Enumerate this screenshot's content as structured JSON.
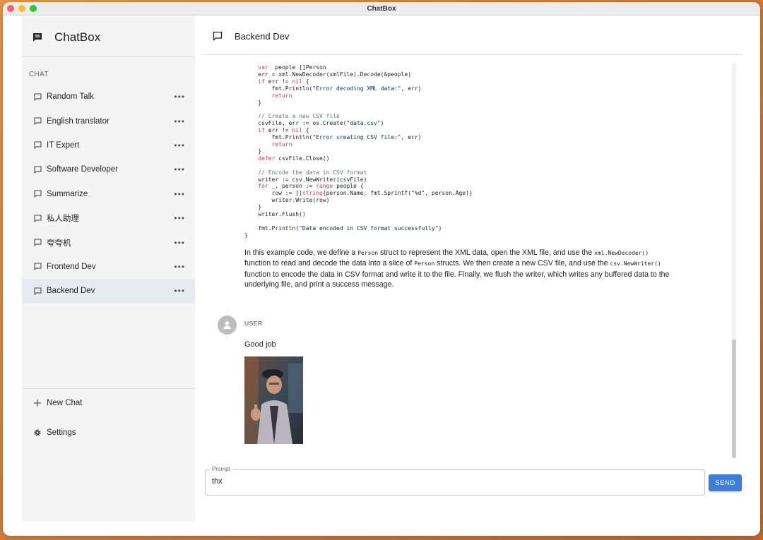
{
  "window": {
    "title": "ChatBox"
  },
  "sidebar": {
    "brand": "ChatBox",
    "section_label": "CHAT",
    "items": [
      {
        "label": "Random Talk"
      },
      {
        "label": "English translator"
      },
      {
        "label": "IT Expert"
      },
      {
        "label": "Software Developer"
      },
      {
        "label": "Summarize"
      },
      {
        "label": "私人助理"
      },
      {
        "label": "夸夸机"
      },
      {
        "label": "Frontend Dev"
      },
      {
        "label": "Backend Dev",
        "active": true
      }
    ],
    "more_glyph": "•••",
    "new_chat": "New Chat",
    "settings": "Settings"
  },
  "main": {
    "title": "Backend Dev",
    "code_lines": [
      {
        "parts": [
          [
            "kw",
            "    var"
          ],
          [
            "",
            "  people []Person"
          ]
        ]
      },
      {
        "parts": [
          [
            "",
            "    err = xml.NewDecoder(xmlFile).Decode(&people)"
          ]
        ]
      },
      {
        "parts": [
          [
            "kw",
            "    if"
          ],
          [
            "",
            " err != "
          ],
          [
            "kw",
            "nil"
          ],
          [
            "",
            " {"
          ]
        ]
      },
      {
        "parts": [
          [
            "",
            "        fmt.Println("
          ],
          [
            "str",
            "\"Error decoding XML data:\""
          ],
          [
            "",
            ", err)"
          ]
        ]
      },
      {
        "parts": [
          [
            "kw",
            "        return"
          ]
        ]
      },
      {
        "parts": [
          [
            "",
            "    }"
          ]
        ]
      },
      {
        "parts": [
          [
            "",
            ""
          ]
        ]
      },
      {
        "parts": [
          [
            "cm",
            "    // Create a new CSV file"
          ]
        ]
      },
      {
        "parts": [
          [
            "",
            "    csvFile, err := os.Create("
          ],
          [
            "str",
            "\"data.csv\""
          ],
          [
            "",
            ")"
          ]
        ]
      },
      {
        "parts": [
          [
            "kw",
            "    if"
          ],
          [
            "",
            " err != "
          ],
          [
            "kw",
            "nil"
          ],
          [
            "",
            " {"
          ]
        ]
      },
      {
        "parts": [
          [
            "",
            "        fmt.Println("
          ],
          [
            "str",
            "\"Error creating CSV file:\""
          ],
          [
            "",
            ", err)"
          ]
        ]
      },
      {
        "parts": [
          [
            "kw",
            "        return"
          ]
        ]
      },
      {
        "parts": [
          [
            "",
            "    }"
          ]
        ]
      },
      {
        "parts": [
          [
            "kw",
            "    defer"
          ],
          [
            "",
            " csvFile.Close()"
          ]
        ]
      },
      {
        "parts": [
          [
            "",
            ""
          ]
        ]
      },
      {
        "parts": [
          [
            "cm",
            "    // Encode the data in CSV format"
          ]
        ]
      },
      {
        "parts": [
          [
            "",
            "    writer := csv.NewWriter(csvFile)"
          ]
        ]
      },
      {
        "parts": [
          [
            "kw",
            "    for"
          ],
          [
            "",
            " _, person := "
          ],
          [
            "kw",
            "range"
          ],
          [
            "",
            " people {"
          ]
        ]
      },
      {
        "parts": [
          [
            "",
            "        row := []"
          ],
          [
            "kw",
            "string"
          ],
          [
            "",
            "{person.Name, fmt.Sprintf("
          ],
          [
            "str",
            "\"%d\""
          ],
          [
            "",
            ", person.Age)}"
          ]
        ]
      },
      {
        "parts": [
          [
            "",
            "        writer.Write(row)"
          ]
        ]
      },
      {
        "parts": [
          [
            "",
            "    }"
          ]
        ]
      },
      {
        "parts": [
          [
            "",
            "    writer.Flush()"
          ]
        ]
      },
      {
        "parts": [
          [
            "",
            ""
          ]
        ]
      },
      {
        "parts": [
          [
            "",
            "    fmt.Println("
          ],
          [
            "str",
            "\"Data encoded in CSV format successfully\""
          ],
          [
            "",
            ")"
          ]
        ]
      },
      {
        "parts": [
          [
            "",
            "}"
          ]
        ]
      }
    ],
    "explanation": [
      [
        "t",
        "In this example code, we define a "
      ],
      [
        "c",
        "Person"
      ],
      [
        "t",
        " struct to represent the XML data, open the XML file, and use the "
      ],
      [
        "c",
        "xml.NewDecoder()"
      ],
      [
        "t",
        " function to read and decode the data into a slice of "
      ],
      [
        "c",
        "Person"
      ],
      [
        "t",
        " structs. We then create a new CSV file, and use the "
      ],
      [
        "c",
        "csv.NewWriter()"
      ],
      [
        "t",
        " function to encode the data in CSV format and write it to the file. Finally, we flush the writer, which writes any buffered data to the underlying file, and print a success message."
      ]
    ],
    "user_role": "USER",
    "user_message": "Good job"
  },
  "prompt": {
    "label": "Prompt",
    "value": "thx",
    "send": "SEND"
  },
  "colors": {
    "accent": "#3b7dd8",
    "keyword": "#d73a49",
    "string": "#032f62",
    "comment": "#6a737d"
  }
}
